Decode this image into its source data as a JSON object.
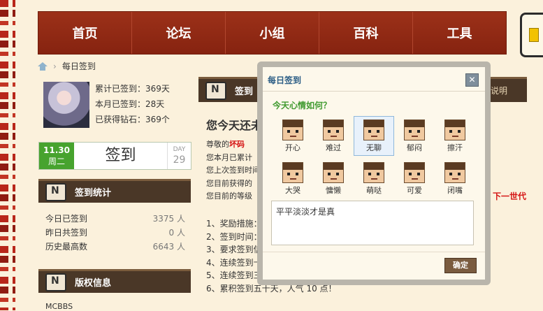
{
  "nav": {
    "items": [
      "首页",
      "论坛",
      "小组",
      "百科",
      "工具"
    ]
  },
  "breadcrumb": {
    "current": "每日签到"
  },
  "user": {
    "total_signed": "累计已签到：369天",
    "month_signed": "本月已签到：28天",
    "diamonds": "已获得钻石：369个"
  },
  "sign": {
    "date": "11.30",
    "weekday": "周二",
    "label": "签到",
    "day_label": "DAY",
    "day_num": "29"
  },
  "stats_section": {
    "title": "签到统计",
    "rows": [
      {
        "label": "今日已签到",
        "value": "3375 人"
      },
      {
        "label": "昨日共签到",
        "value": "0 人"
      },
      {
        "label": "历史最高数",
        "value": "6643 人"
      }
    ]
  },
  "copyright_section": {
    "title": "版权信息",
    "text": "MCBBS"
  },
  "main": {
    "header": "签到",
    "rules_link": "规说明",
    "title": "您今天还未",
    "lines": [
      "尊敬的",
      "您本月已累计",
      "您上次签到时间",
      "您目前获得的",
      "您目前的等级"
    ],
    "highlight_name": "坏码",
    "next_gen": "下一世代",
    "list": [
      "1、奖励措施：",
      "2、签到时间：",
      "3、要求签到信",
      "4、连续签到十",
      "5、连续签到三",
      "6、累积签到五十天，人气 10 点！"
    ]
  },
  "dialog": {
    "title": "每日签到",
    "close": "✕",
    "question": "今天心情如何？",
    "moods": [
      "开心",
      "难过",
      "无聊",
      "郁闷",
      "擦汗",
      "大哭",
      "慵懒",
      "萌哒",
      "可爱",
      "闭嘴"
    ],
    "selected_mood": "无聊",
    "textarea": "平平淡淡才是真",
    "ok": "确定"
  }
}
